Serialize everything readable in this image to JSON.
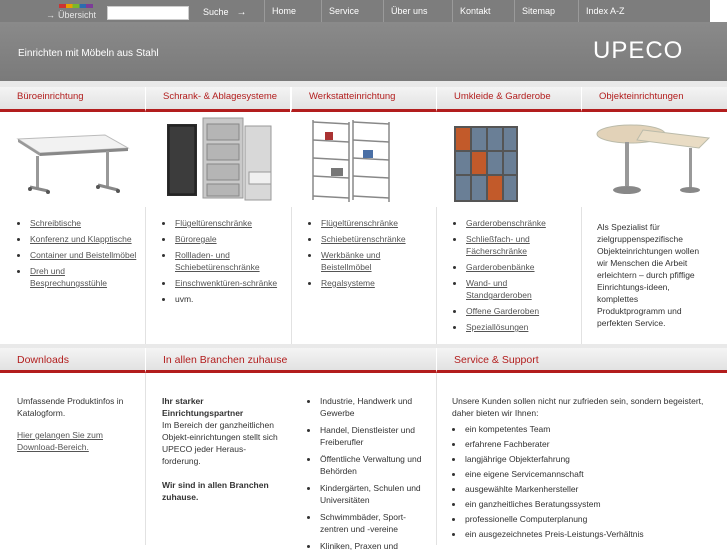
{
  "topnav": {
    "overview": "Übersicht",
    "search_placeholder": "",
    "search_label": "Suche",
    "items": [
      "Home",
      "Service",
      "Über uns",
      "Kontakt",
      "Sitemap",
      "Index A-Z"
    ]
  },
  "header": {
    "tagline": "Einrichten mit Möbeln aus Stahl",
    "logo": "UPECO"
  },
  "categories": [
    {
      "label": "Büroeinrichtung",
      "items": [
        "Schreibtische",
        "Konferenz und Klapptische",
        "Container und Beistellmöbel",
        "Dreh und Besprechungsstühle"
      ]
    },
    {
      "label": "Schrank- & Ablagesysteme",
      "items": [
        "Flügeltürenschränke",
        "Büroregale",
        "Rollladen- und Schiebetürenschränke",
        "Einschwenktüren-schränke"
      ],
      "plain": "uvm."
    },
    {
      "label": "Werkstatteinrichtung",
      "items": [
        "Flügeltürenschränke",
        "Schiebetürenschränke",
        "Werkbänke und Beistellmöbel",
        "Regalsysteme"
      ]
    },
    {
      "label": "Umkleide & Garderobe",
      "items": [
        "Garderobenschränke",
        "Schließfach- und Fächerschränke",
        "Garderobenbänke",
        "Wand- und Standgarderoben",
        "Offene Garderoben",
        "Speziallösungen"
      ]
    },
    {
      "label": "Objekteinrichtungen",
      "text": "Als Spezialist für zielgruppenspezifische Objekteinrichtungen wollen wir Menschen die Arbeit erleichtern – durch pfiffige Einrichtungs-ideen, komplettes Produktprogramm und perfekten Service."
    }
  ],
  "sections": {
    "downloads": {
      "title": "Downloads",
      "text": "Umfassende Produktinfos in Katalogform.",
      "link": "Hier gelangen Sie zum Download-Bereich."
    },
    "branchen": {
      "title": "In allen Branchen zuhause",
      "bold1": "Ihr starker Einrichtungspartner",
      "text": "Im Bereich der ganzheitlichen Objekt-einrichtungen stellt sich UPECO jeder Heraus-forderung.",
      "bold2": "Wir sind in allen Branchen zuhause.",
      "items": [
        "Industrie, Handwerk und Gewerbe",
        "Handel, Dienstleister und Freiberufler",
        "Öffentliche Verwaltung und Behörden",
        "Kindergärten, Schulen und Universitäten",
        "Schwimmbäder, Sport-zentren und -vereine",
        "Kliniken, Praxen und"
      ]
    },
    "service": {
      "title": "Service & Support",
      "intro": "Unsere Kunden sollen nicht nur zufrieden sein, sondern begeistert, daher bieten wir Ihnen:",
      "items": [
        "ein kompetentes Team",
        "erfahrene Fachberater",
        "langjährige Objekterfahrung",
        "eine eigene Servicemannschaft",
        "ausgewählte Markenhersteller",
        "ein ganzheitliches Beratungssystem",
        "professionelle Computerplanung",
        "ein ausgezeichnetes Preis-Leistungs-Verhältnis"
      ]
    }
  }
}
